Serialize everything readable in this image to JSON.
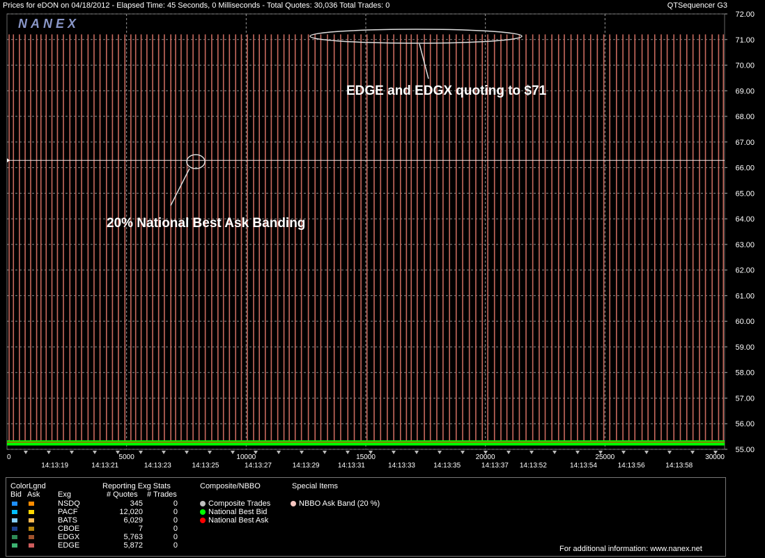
{
  "header": {
    "title": "Prices for  eDON  on  04/18/2012  -  Elapsed Time: 45 Seconds, 0 Milliseconds  -  Total Quotes: 30,036  Total Trades: 0",
    "app_name": "QTSequencer G3"
  },
  "logo": "NANEX",
  "annotations": {
    "top": "EDGE and EDGX quoting to $71",
    "left": "20% National Best Ask Banding"
  },
  "chart_data": {
    "type": "line",
    "title": "",
    "xlabel": "",
    "ylabel": "",
    "ylim": [
      55.0,
      72.0
    ],
    "xlim": [
      0,
      30000
    ],
    "y_ticks": [
      "55.00",
      "56.00",
      "57.00",
      "58.00",
      "59.00",
      "60.00",
      "61.00",
      "62.00",
      "63.00",
      "64.00",
      "65.00",
      "66.00",
      "67.00",
      "68.00",
      "69.00",
      "70.00",
      "71.00",
      "72.00"
    ],
    "x_ticks": [
      {
        "value": 0,
        "label": "0"
      },
      {
        "value": 5000,
        "label": "5000"
      },
      {
        "value": 10000,
        "label": "10000"
      },
      {
        "value": 15000,
        "label": "15000"
      },
      {
        "value": 20000,
        "label": "20000"
      },
      {
        "value": 25000,
        "label": "25000"
      },
      {
        "value": 30000,
        "label": "30000"
      }
    ],
    "time_labels": [
      {
        "value": 2000,
        "label": "14:13:19"
      },
      {
        "value": 4100,
        "label": "14:13:21"
      },
      {
        "value": 6300,
        "label": "14:13:23"
      },
      {
        "value": 8300,
        "label": "14:13:25"
      },
      {
        "value": 10500,
        "label": "14:13:27"
      },
      {
        "value": 12500,
        "label": "14:13:29"
      },
      {
        "value": 14400,
        "label": "14:13:31"
      },
      {
        "value": 16500,
        "label": "14:13:33"
      },
      {
        "value": 18400,
        "label": "14:13:35"
      },
      {
        "value": 20400,
        "label": "14:13:37"
      },
      {
        "value": 22000,
        "label": "14:13:52"
      },
      {
        "value": 24100,
        "label": "14:13:54"
      },
      {
        "value": 26100,
        "label": "14:13:56"
      },
      {
        "value": 28100,
        "label": "14:13:58"
      }
    ],
    "grid": true,
    "series": [
      {
        "name": "NBBO Ask Band (20 %)",
        "color": "#f5e6e6",
        "values": [
          [
            0,
            66.28
          ],
          [
            30000,
            66.28
          ]
        ]
      },
      {
        "name": "National Best Bid",
        "color": "#00ff00",
        "values": [
          [
            0,
            55.25
          ],
          [
            30000,
            55.25
          ]
        ]
      },
      {
        "name": "National Best Ask",
        "color": "#ff0000",
        "values": [
          [
            0,
            55.28
          ],
          [
            30000,
            55.28
          ]
        ]
      },
      {
        "name": "EDGX / EDGE Ask spikes",
        "color": "#c86a5e",
        "spike_from": 55.3,
        "spike_to": 71.2,
        "x": [
          90,
          270,
          520,
          760,
          990,
          1240,
          1420,
          1640,
          1880,
          2110,
          2360,
          2630,
          2880,
          3120,
          3390,
          3640,
          3890,
          4160,
          4410,
          4660,
          4930,
          5180,
          5380,
          5610,
          5850,
          6090,
          6340,
          6580,
          6850,
          7050,
          7280,
          7530,
          7780,
          8030,
          8290,
          8560,
          8820,
          9050,
          9300,
          9560,
          9800,
          10050,
          10310,
          10550,
          10800,
          11050,
          11320,
          11580,
          11800,
          12050,
          12310,
          12600,
          12880,
          13120,
          13400,
          13680,
          13950,
          14250,
          14520,
          14800,
          15050,
          15350,
          15620,
          15900,
          16170,
          16450,
          16700,
          16900,
          17150,
          17450,
          17700,
          17970,
          18230,
          18500,
          18780,
          19050,
          19330,
          19600,
          19870,
          20100,
          20380,
          20650,
          20900,
          21150,
          21420,
          21700,
          21980,
          22250,
          22500,
          22780,
          23060,
          23300,
          23580,
          23850,
          24120,
          24400,
          24680,
          24950,
          25200,
          25480,
          25750,
          26000,
          26250,
          26550,
          26800,
          27080,
          27350,
          27600,
          27880,
          28150,
          28420,
          28680,
          28950,
          29200,
          29480,
          29750,
          29950
        ]
      }
    ]
  },
  "legend": {
    "color_legend": {
      "title": "ColorLgnd",
      "bid_header": "Bid",
      "ask_header": "Ask",
      "exg_header": "Exg",
      "rows": [
        {
          "exg": "NSDQ",
          "bid_color": "#1e90ff",
          "ask_color": "#ff8c00"
        },
        {
          "exg": "PACF",
          "bid_color": "#00bfff",
          "ask_color": "#ffd700"
        },
        {
          "exg": "BATS",
          "bid_color": "#87cefa",
          "ask_color": "#ffbb55"
        },
        {
          "exg": "CBOE",
          "bid_color": "#1c3f8f",
          "ask_color": "#b8860b"
        },
        {
          "exg": "EDGX",
          "bid_color": "#2e8b57",
          "ask_color": "#a0522d"
        },
        {
          "exg": "EDGE",
          "bid_color": "#3cb371",
          "ask_color": "#cd5c5c"
        }
      ]
    },
    "exg_stats": {
      "title": "Reporting Exg Stats",
      "quotes_header": "# Quotes",
      "trades_header": "# Trades",
      "rows": [
        {
          "quotes": "345",
          "trades": "0"
        },
        {
          "quotes": "12,020",
          "trades": "0"
        },
        {
          "quotes": "6,029",
          "trades": "0"
        },
        {
          "quotes": "7",
          "trades": "0"
        },
        {
          "quotes": "5,763",
          "trades": "0"
        },
        {
          "quotes": "5,872",
          "trades": "0"
        }
      ]
    },
    "composite": {
      "title": "Composite/NBBO",
      "items": [
        {
          "label": "Composite Trades",
          "color": "#c0c0c0"
        },
        {
          "label": "National Best Bid",
          "color": "#00ff00"
        },
        {
          "label": "National Best Ask",
          "color": "#ff0000"
        }
      ]
    },
    "special": {
      "title": "Special Items",
      "items": [
        {
          "label": "NBBO Ask Band (20 %)",
          "color": "#f5c6c0"
        }
      ]
    },
    "footer": "For additional information: www.nanex.net"
  }
}
